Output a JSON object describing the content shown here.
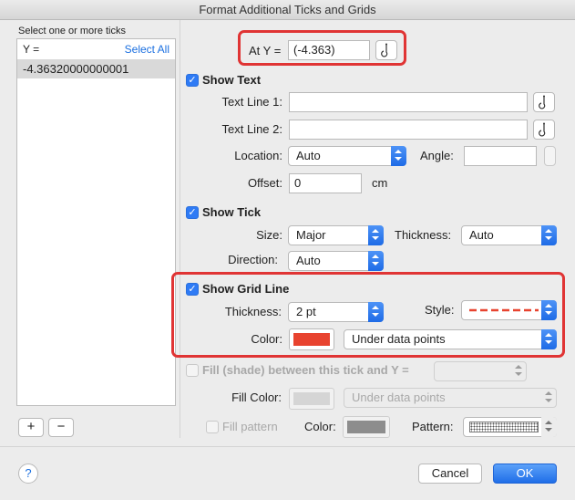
{
  "window": {
    "title": "Format Additional Ticks and Grids"
  },
  "left_panel": {
    "caption": "Select one or more ticks",
    "list_header": "Y =",
    "select_all": "Select All",
    "items": [
      "-4.36320000000001"
    ],
    "add_label": "+",
    "remove_label": "−"
  },
  "at_y": {
    "label": "At Y =",
    "value": "(-4.363)"
  },
  "show_text": {
    "checkbox_label": "Show Text",
    "checked": true,
    "text_line1_label": "Text Line 1:",
    "text_line1_value": "",
    "text_line2_label": "Text Line 2:",
    "text_line2_value": "",
    "location_label": "Location:",
    "location_value": "Auto",
    "angle_label": "Angle:",
    "angle_value": "",
    "offset_label": "Offset:",
    "offset_value": "0",
    "offset_unit": "cm"
  },
  "show_tick": {
    "checkbox_label": "Show Tick",
    "checked": true,
    "size_label": "Size:",
    "size_value": "Major",
    "thickness_label": "Thickness:",
    "thickness_value": "Auto",
    "direction_label": "Direction:",
    "direction_value": "Auto"
  },
  "show_grid_line": {
    "checkbox_label": "Show Grid Line",
    "checked": true,
    "thickness_label": "Thickness:",
    "thickness_value": "2 pt",
    "style_label": "Style:",
    "color_label": "Color:",
    "color_hex": "#e8432f",
    "layer_value": "Under data points"
  },
  "fill": {
    "checkbox_label": "Fill (shade) between this tick and Y =",
    "checked": false,
    "value": "",
    "fill_color_label": "Fill Color:",
    "fill_color_hex": "#d5d5d5",
    "layer_value": "Under data points",
    "fill_pattern_label": "Fill pattern",
    "fill_pattern_checked": false,
    "color_label": "Color:",
    "color_hex": "#8d8d8d",
    "pattern_label": "Pattern:"
  },
  "footer": {
    "help_label": "?",
    "cancel_label": "Cancel",
    "ok_label": "OK"
  },
  "colors": {
    "accent": "#2f7bf5",
    "highlight": "#e03434",
    "grid_line_dash": "#e8432f"
  }
}
